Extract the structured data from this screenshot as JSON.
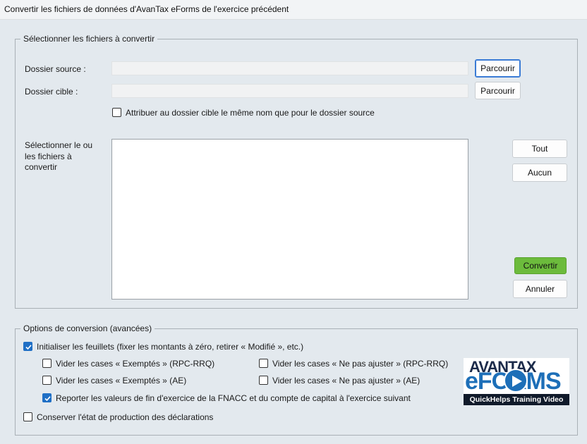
{
  "window": {
    "title": "Convertir les fichiers de données d'AvanTax eForms de l'exercice précédent"
  },
  "files_group": {
    "legend": "Sélectionner les fichiers  à convertir",
    "source_label": "Dossier source :",
    "source_value": "",
    "target_label": "Dossier cible :",
    "target_value": "",
    "browse_label": "Parcourir",
    "same_name_label": "Attribuer au dossier cible le même nom que pour le dossier source",
    "same_name_checked": false,
    "select_files_label": "Sélectionner le ou les fichiers à convertir",
    "all_label": "Tout",
    "none_label": "Aucun",
    "convert_label": "Convertir",
    "cancel_label": "Annuler"
  },
  "options_group": {
    "legend": "Options de conversion (avancées)",
    "init_sheets_label": "Initialiser les feuillets (fixer les montants à zéro, retirer « Modifié », etc.)",
    "init_sheets_checked": true,
    "clear_exempt_rpc_label": "Vider les cases « Exemptés » (RPC-RRQ)",
    "clear_exempt_rpc_checked": false,
    "clear_noadjust_rpc_label": "Vider les cases « Ne pas ajuster » (RPC-RRQ)",
    "clear_noadjust_rpc_checked": false,
    "clear_exempt_ae_label": "Vider les cases « Exemptés » (AE)",
    "clear_exempt_ae_checked": false,
    "clear_noadjust_ae_label": "Vider les cases « Ne pas ajuster » (AE)",
    "clear_noadjust_ae_checked": false,
    "carry_forward_label": "Reporter les valeurs de fin d'exercice de la FNACC et du compte de capital à l'exercice suivant",
    "carry_forward_checked": true,
    "keep_status_label": "Conserver l'état de production des déclarations",
    "keep_status_checked": false
  },
  "logo": {
    "brand_top": "AVANTAX",
    "brand_main": "eFORMS",
    "caption": "QuickHelps Training Video"
  },
  "colors": {
    "accent": "#1f6fc5",
    "convert_button": "#6cbb3c"
  }
}
